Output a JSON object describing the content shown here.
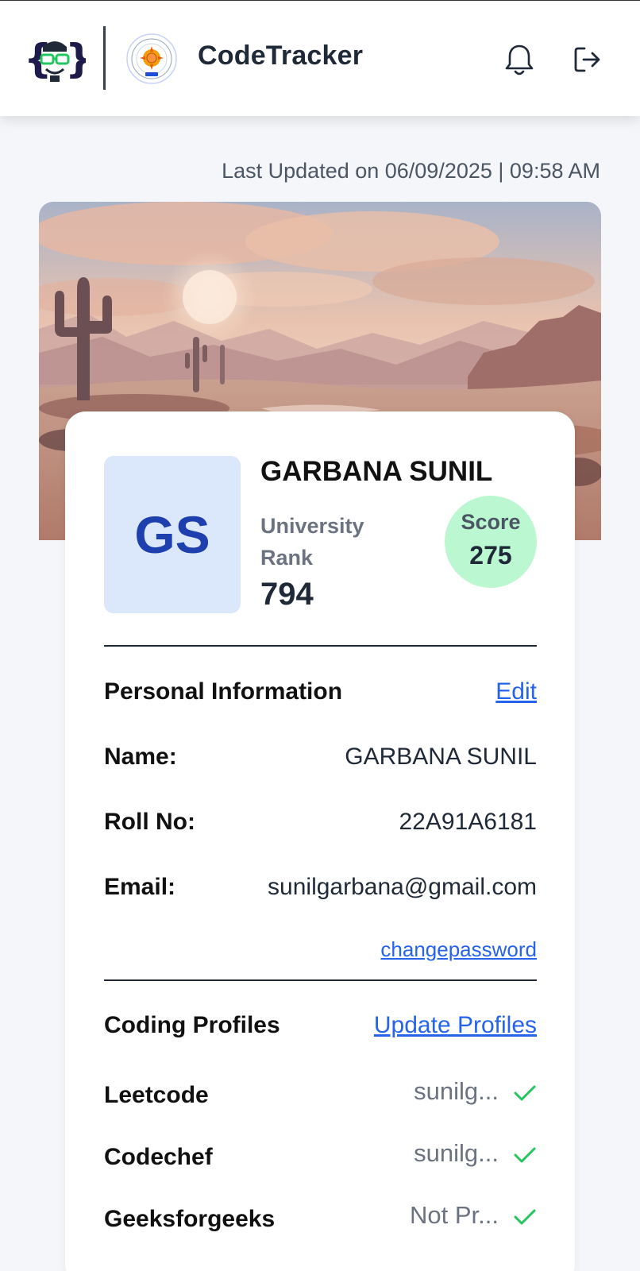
{
  "header": {
    "app_title": "CodeTracker",
    "icons": [
      "codetracker-logo-icon",
      "college-logo-icon",
      "bell-icon",
      "logout-icon"
    ]
  },
  "last_updated": "Last Updated on 06/09/2025 | 09:58 AM",
  "profile": {
    "initials": "GS",
    "name": "GARBANA SUNIL",
    "rank_label": "University Rank",
    "rank_value": "794",
    "score_label": "Score",
    "score_value": "275"
  },
  "personal_info": {
    "title": "Personal Information",
    "edit_label": "Edit",
    "name_label": "Name:",
    "name_value": "GARBANA SUNIL",
    "roll_label": "Roll No:",
    "roll_value": "22A91A6181",
    "email_label": "Email:",
    "email_value": "sunilgarbana@gmail.com",
    "change_password_label": "changepassword"
  },
  "coding_profiles": {
    "title": "Coding Profiles",
    "update_label": "Update Profiles",
    "items": [
      {
        "platform": "Leetcode",
        "handle": "sunilg...",
        "verified": true
      },
      {
        "platform": "Codechef",
        "handle": "sunilg...",
        "verified": true
      },
      {
        "platform": "Geeksforgeeks",
        "handle": "Not Pr...",
        "verified": true
      }
    ]
  },
  "colors": {
    "accent_link": "#2563eb",
    "score_bg": "#bbf7d0",
    "avatar_bg": "#dbe8fb",
    "avatar_text": "#1e40af",
    "check_green": "#22c55e"
  }
}
